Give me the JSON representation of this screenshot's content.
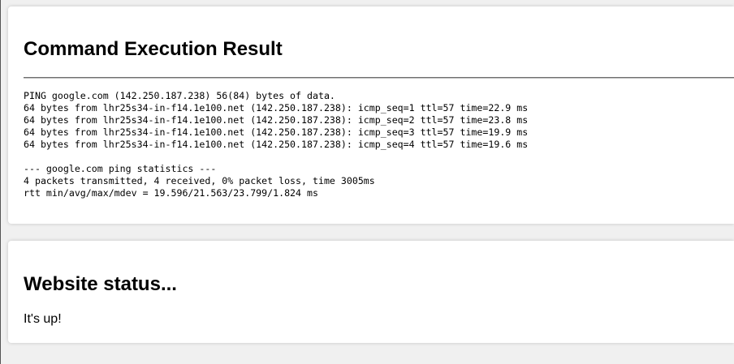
{
  "result_card": {
    "title": "Command Execution Result",
    "output_lines": [
      "PING google.com (142.250.187.238) 56(84) bytes of data.",
      "64 bytes from lhr25s34-in-f14.1e100.net (142.250.187.238): icmp_seq=1 ttl=57 time=22.9 ms",
      "64 bytes from lhr25s34-in-f14.1e100.net (142.250.187.238): icmp_seq=2 ttl=57 time=23.8 ms",
      "64 bytes from lhr25s34-in-f14.1e100.net (142.250.187.238): icmp_seq=3 ttl=57 time=19.9 ms",
      "64 bytes from lhr25s34-in-f14.1e100.net (142.250.187.238): icmp_seq=4 ttl=57 time=19.6 ms",
      "",
      "--- google.com ping statistics ---",
      "4 packets transmitted, 4 received, 0% packet loss, time 3005ms",
      "rtt min/avg/max/mdev = 19.596/21.563/23.799/1.824 ms"
    ]
  },
  "status_card": {
    "title": "Website status...",
    "message": "It's up!"
  }
}
